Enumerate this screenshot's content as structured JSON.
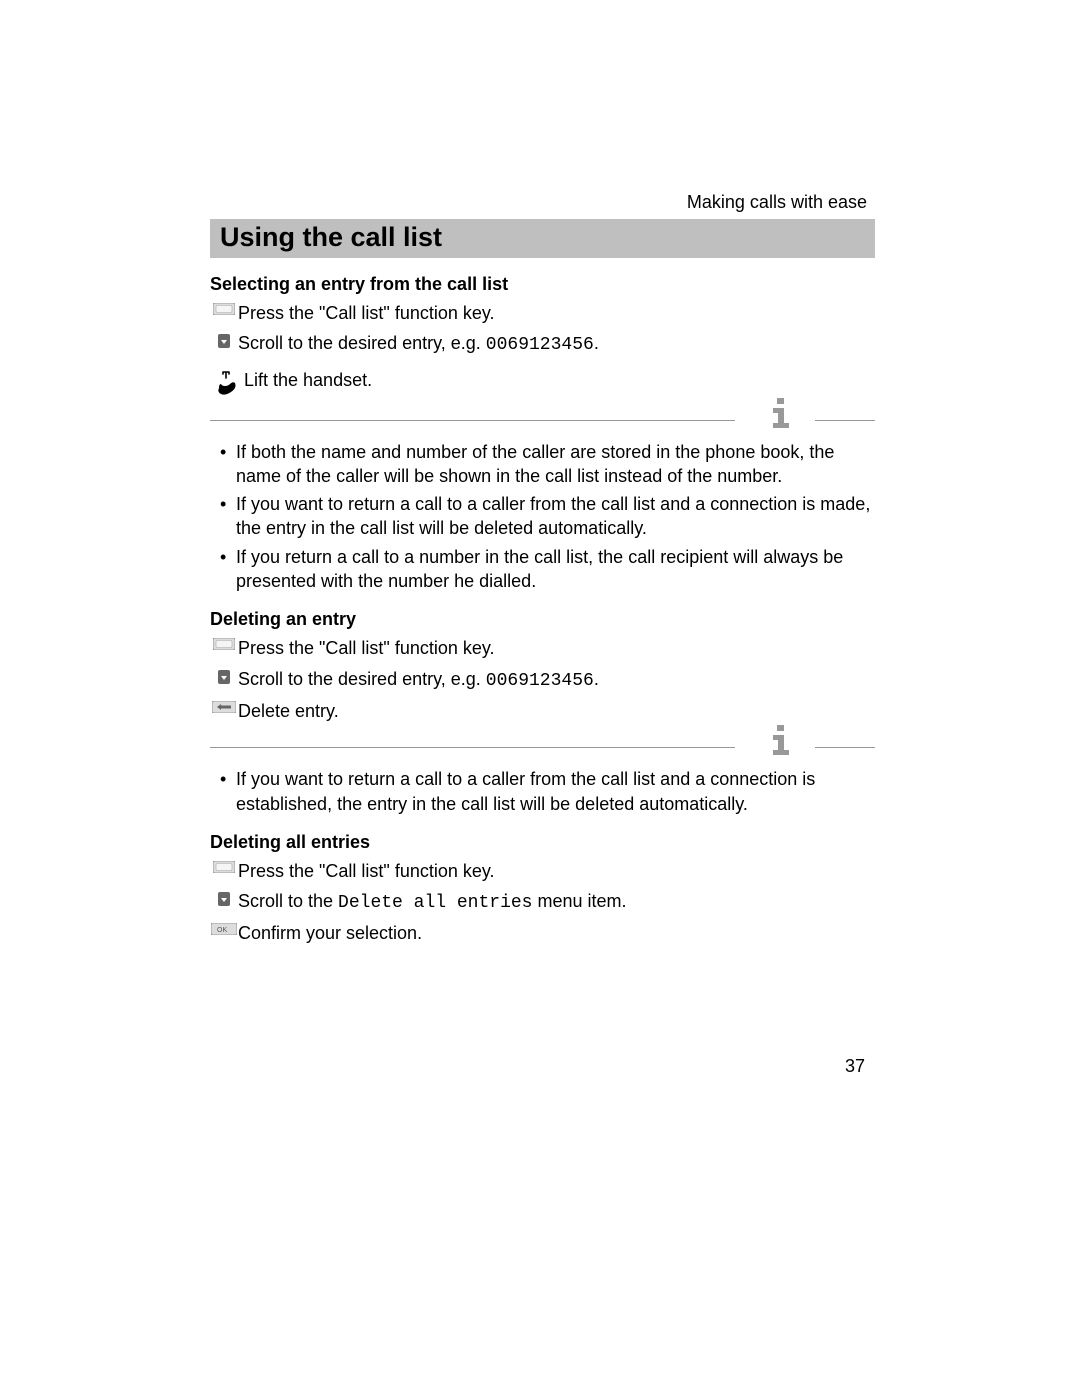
{
  "running_head": "Making calls with ease",
  "title": "Using the call list",
  "page_number": "37",
  "sections": {
    "select": {
      "heading": "Selecting an entry from the call list",
      "step1": "Press the \"Call list\" function key.",
      "step2_pre": "Scroll to the desired entry, e.g. ",
      "step2_code": "0069123456",
      "step2_post": ".",
      "step3": "Lift the handset.",
      "notes": {
        "n1": "If both the name and number of the caller are stored in the phone book, the name of the caller will be shown in the call list instead of the number.",
        "n2": "If you want to return a call to a caller from the call list and a connection is made, the entry in the call list will be deleted automatically.",
        "n3": "If you return a call to a number in the call list, the call recipient will always be presented with the number he dialled."
      }
    },
    "delete_one": {
      "heading": "Deleting an entry",
      "step1": "Press the \"Call list\" function key.",
      "step2_pre": "Scroll to the desired entry, e.g. ",
      "step2_code": "0069123456",
      "step2_post": ".",
      "step3": "Delete entry.",
      "notes": {
        "n1": "If you want to return a call to a caller from the call list and a connection is established, the entry in the call list will be deleted automatically."
      }
    },
    "delete_all": {
      "heading": "Deleting all entries",
      "step1": "Press the \"Call list\" function key.",
      "step2_pre": "Scroll to the ",
      "step2_code": "Delete all entries",
      "step2_post": " menu item.",
      "step3": "Confirm your selection."
    }
  }
}
